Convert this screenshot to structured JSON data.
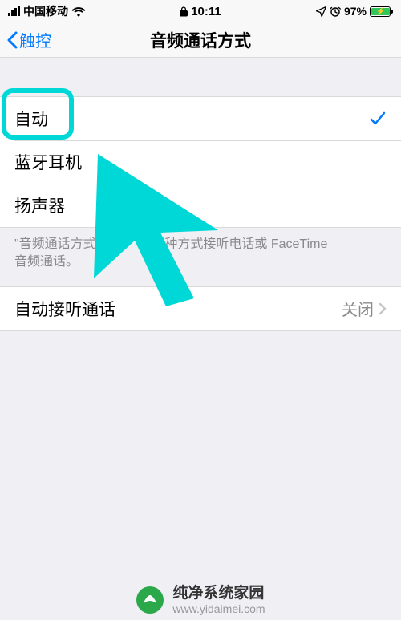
{
  "statusbar": {
    "carrier": "中国移动",
    "time": "10:11",
    "battery_percent": "97%"
  },
  "nav": {
    "back_label": "触控",
    "title": "音频通话方式"
  },
  "routes": {
    "auto": "自动",
    "bluetooth": "蓝牙耳机",
    "speaker": "扬声器"
  },
  "footer_line1_prefix": "\"音频通话方式\"可",
  "footer_line1_suffix": "哪种方式接听电话或 FaceTime",
  "footer_line2": "音频通话。",
  "auto_answer": {
    "label": "自动接听通话",
    "value": "关闭"
  },
  "watermark": {
    "title": "纯净系统家园",
    "url": "www.yidaimei.com"
  }
}
